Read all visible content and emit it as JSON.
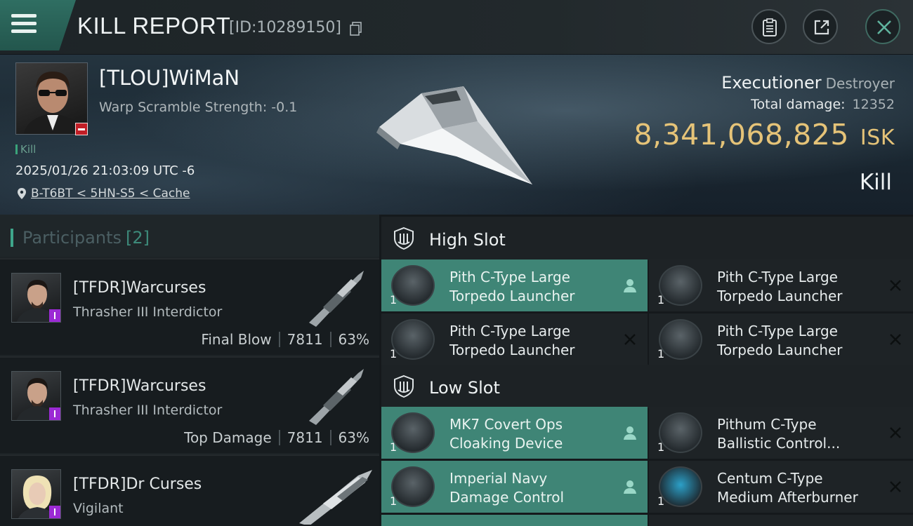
{
  "header": {
    "title": "KILL REPORT",
    "report_id": "[ID:10289150]"
  },
  "victim": {
    "name": "[TLOU]WiMaN",
    "warp_scramble": "Warp Scramble Strength: -0.1",
    "kill_tag": "Kill",
    "datetime": "2025/01/26 21:03:09 UTC -6",
    "location": "B-T6BT < 5HN-S5 < Cache",
    "ship": "Executioner",
    "ship_class": "Destroyer",
    "total_damage_label": "Total damage:",
    "total_damage": "12352",
    "isk_value": "8,341,068,825",
    "isk_unit": "ISK",
    "result": "Kill"
  },
  "participants": {
    "title": "Participants",
    "count": "[2]",
    "items": [
      {
        "name": "[TFDR]Warcurses",
        "ship": "Thrasher III Interdictor",
        "role": "Final Blow",
        "damage": "7811",
        "percent": "63%"
      },
      {
        "name": "[TFDR]Warcurses",
        "ship": "Thrasher III Interdictor",
        "role": "Top Damage",
        "damage": "7811",
        "percent": "63%"
      },
      {
        "name": "[TFDR]Dr Curses",
        "ship": "Vigilant",
        "role": "",
        "damage": "",
        "percent": ""
      }
    ]
  },
  "slots": {
    "high": {
      "title": "High Slot",
      "modules": [
        {
          "line1": "Pith C-Type Large",
          "line2": "Torpedo Launcher",
          "qty": "1",
          "status": "fitted"
        },
        {
          "line1": "Pith C-Type Large",
          "line2": "Torpedo Launcher",
          "qty": "1",
          "status": "destroyed"
        },
        {
          "line1": "Pith C-Type Large",
          "line2": "Torpedo Launcher",
          "qty": "1",
          "status": "destroyed"
        },
        {
          "line1": "Pith C-Type Large",
          "line2": "Torpedo Launcher",
          "qty": "1",
          "status": "destroyed"
        }
      ]
    },
    "low": {
      "title": "Low Slot",
      "modules": [
        {
          "line1": "MK7 Covert Ops",
          "line2": "Cloaking Device",
          "qty": "1",
          "status": "fitted"
        },
        {
          "line1": "Pithum C-Type",
          "line2": "Ballistic Control...",
          "qty": "1",
          "status": "destroyed"
        },
        {
          "line1": "Imperial Navy",
          "line2": "Damage Control",
          "qty": "1",
          "status": "fitted"
        },
        {
          "line1": "Centum C-Type",
          "line2": "Medium Afterburner",
          "qty": "1",
          "status": "destroyed"
        }
      ]
    }
  },
  "icons": {
    "menu": "hamburger-icon",
    "copy": "copy-icon",
    "clipboard": "clipboard-icon",
    "share": "share-icon",
    "close": "close-icon",
    "location": "pin-icon",
    "slot": "shield-icon",
    "fitted": "person-icon",
    "destroyed": "x-icon"
  },
  "colors": {
    "accent": "#3f8576",
    "isk": "#e5c378",
    "security_status": "#c21e26",
    "pilot_badge": "#9b2ad4"
  }
}
